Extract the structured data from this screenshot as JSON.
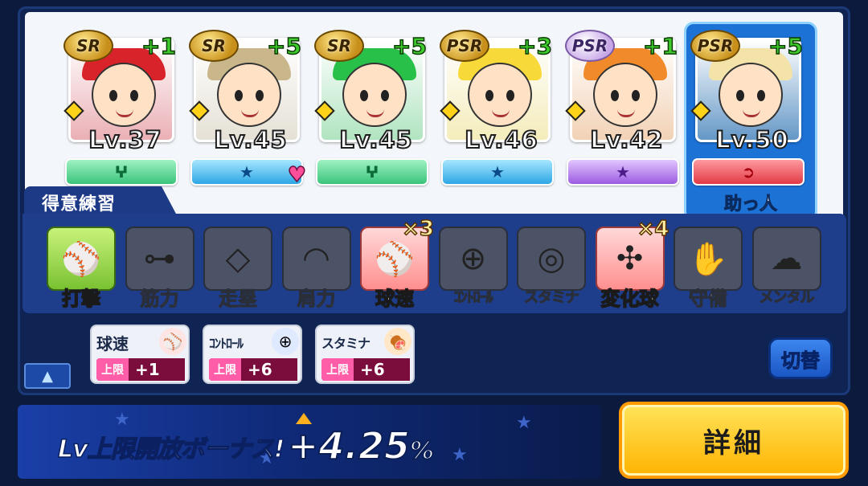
{
  "deck": {
    "cards": [
      {
        "rarity": "SR",
        "plus": "+1",
        "level": "Lv.37",
        "type_color": "green",
        "type_icon": "ⵖ",
        "hair": "#d8232a",
        "helper": false,
        "heart": false
      },
      {
        "rarity": "SR",
        "plus": "+5",
        "level": "Lv.45",
        "type_color": "blue",
        "type_icon": "★",
        "hair": "#c9b68a",
        "helper": false,
        "heart": true
      },
      {
        "rarity": "SR",
        "plus": "+5",
        "level": "Lv.45",
        "type_color": "green",
        "type_icon": "ⵖ",
        "hair": "#29c04a",
        "helper": false,
        "heart": false
      },
      {
        "rarity": "PSR",
        "plus": "+3",
        "level": "Lv.46",
        "type_color": "blue",
        "type_icon": "★",
        "hair": "#f7d93a",
        "helper": false,
        "heart": false
      },
      {
        "rarity": "PSR",
        "plus": "+1",
        "level": "Lv.42",
        "type_color": "purple",
        "type_icon": "★",
        "hair": "#f08a2a",
        "helper": false,
        "heart": false
      },
      {
        "rarity": "PSR",
        "plus": "+5",
        "level": "Lv.50",
        "type_color": "red",
        "type_icon": "➲",
        "hair": "#f3e3a8",
        "helper": true,
        "heart": false
      }
    ],
    "helper_label": "助っ人"
  },
  "practice": {
    "tab_label": "得意練習",
    "skills": [
      {
        "name": "打撃",
        "icon": "bat-icon",
        "glyph": "⚾",
        "state": "active",
        "mult": ""
      },
      {
        "name": "筋力",
        "icon": "dumbbell-icon",
        "glyph": "⊶",
        "state": "inactive",
        "mult": ""
      },
      {
        "name": "走塁",
        "icon": "base-icon",
        "glyph": "◇",
        "state": "inactive",
        "mult": ""
      },
      {
        "name": "肩力",
        "icon": "arm-icon",
        "glyph": "◠",
        "state": "inactive",
        "mult": ""
      },
      {
        "name": "球速",
        "icon": "fastball-icon",
        "glyph": "⚾",
        "state": "boost",
        "mult": "×3"
      },
      {
        "name": "ｺﾝﾄﾛｰﾙ",
        "icon": "target-icon",
        "glyph": "⊕",
        "state": "inactive",
        "mult": ""
      },
      {
        "name": "スタミナ",
        "icon": "tire-icon",
        "glyph": "◎",
        "state": "inactive",
        "mult": ""
      },
      {
        "name": "変化球",
        "icon": "breaking-ball-icon",
        "glyph": "✣",
        "state": "boost",
        "mult": "×4"
      },
      {
        "name": "守備",
        "icon": "glove-icon",
        "glyph": "✋",
        "state": "inactive",
        "mult": ""
      },
      {
        "name": "メンタル",
        "icon": "mental-icon",
        "glyph": "☁",
        "state": "inactive",
        "mult": ""
      }
    ]
  },
  "limits": [
    {
      "name": "球速",
      "badge_label": "上限",
      "value": "+1",
      "icon": "fastball-icon",
      "glyph": "⚾"
    },
    {
      "name": "ｺﾝﾄﾛｰﾙ",
      "badge_label": "上限",
      "value": "+6",
      "icon": "target-icon",
      "glyph": "⊕"
    },
    {
      "name": "スタミナ",
      "badge_label": "上限",
      "value": "+6",
      "icon": "meat-icon",
      "glyph": "🍖"
    }
  ],
  "buttons": {
    "collapse_glyph": "▲",
    "switch_label": "切替",
    "detail_label": "詳細"
  },
  "bonus": {
    "label": "Lv上限開放ボーナス!",
    "value": "+4.25",
    "unit": "%"
  },
  "colors": {
    "frame_bg": "#0f2452",
    "accent_blue": "#1d72d6",
    "detail_yellow": "#ffc300"
  }
}
